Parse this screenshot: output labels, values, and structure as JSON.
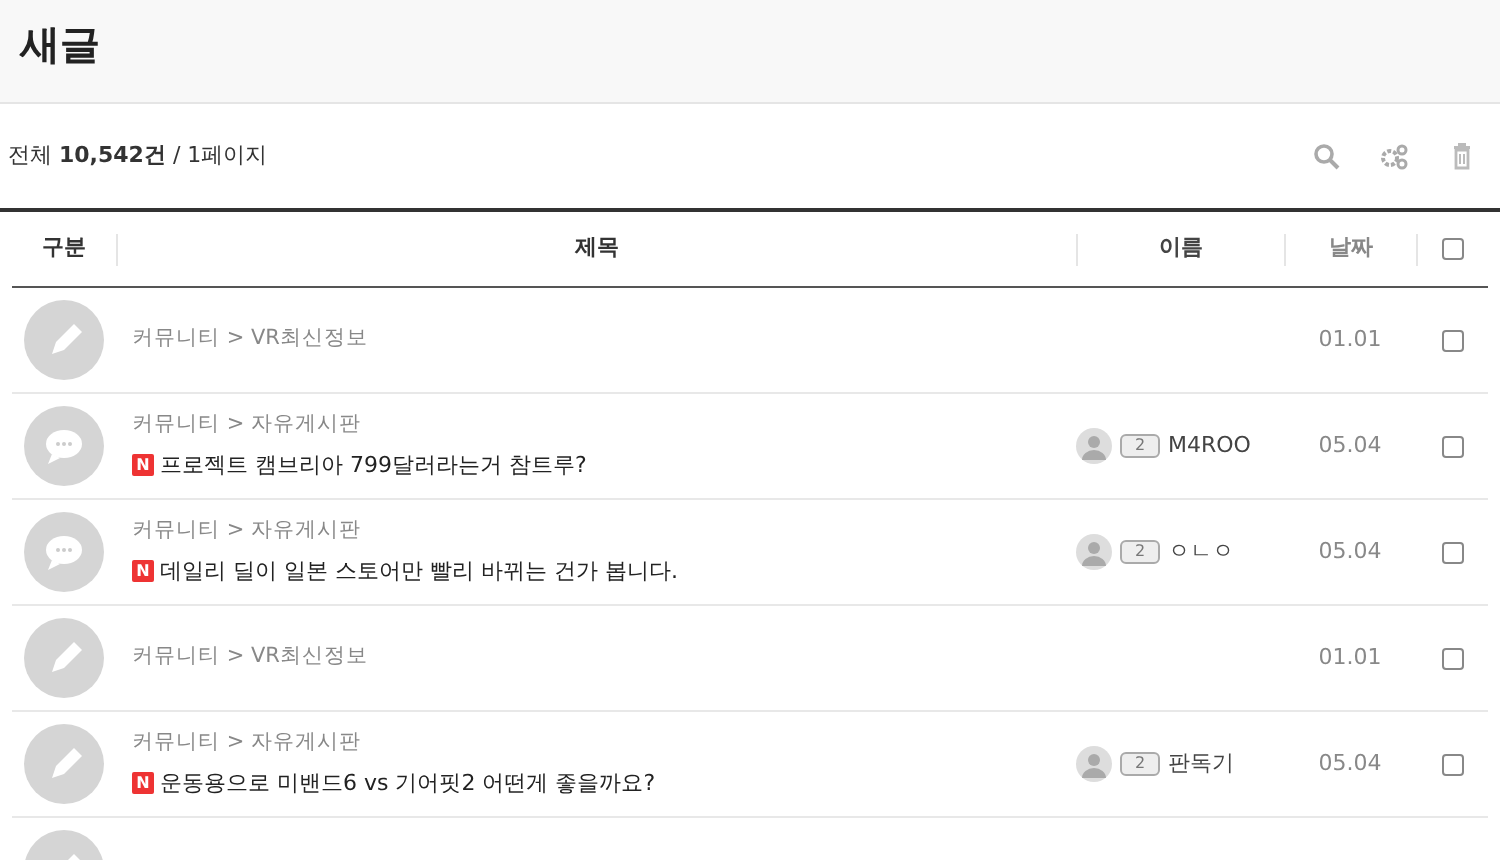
{
  "page_title": "새글",
  "summary": {
    "label": "전체",
    "count": "10,542건",
    "page": "/ 1페이지"
  },
  "toolbar": [
    {
      "kind": "search"
    },
    {
      "kind": "settings"
    },
    {
      "kind": "delete"
    }
  ],
  "columns": [
    "구분",
    "제목",
    "이름",
    "날짜"
  ],
  "header_checkbox": {
    "checked": false
  },
  "rows": [
    {
      "kind": "pencil",
      "category": "커뮤니티 > VR최신정보",
      "date": "01.01",
      "checked": false
    },
    {
      "kind": "chat",
      "category": "커뮤니티 > 자유게시판",
      "new_badge": "N",
      "title": "프로젝트 캠브리아 799달러라는거 참트루?",
      "level": "2",
      "author": "M4ROO",
      "date": "05.04",
      "checked": false
    },
    {
      "kind": "chat",
      "category": "커뮤니티 > 자유게시판",
      "new_badge": "N",
      "title": "데일리 딜이 일본 스토어만 빨리 바뀌는 건가 봅니다.",
      "level": "2",
      "author": "ㅇㄴㅇ",
      "date": "05.04",
      "checked": false
    },
    {
      "kind": "pencil",
      "category": "커뮤니티 > VR최신정보",
      "date": "01.01",
      "checked": false
    },
    {
      "kind": "pencil",
      "category": "커뮤니티 > 자유게시판",
      "new_badge": "N",
      "title": "운동용으로 미밴드6 vs 기어핏2 어떤게 좋을까요?",
      "level": "2",
      "author": "판독기",
      "date": "05.04",
      "checked": false
    },
    {
      "kind": "pencil"
    }
  ]
}
